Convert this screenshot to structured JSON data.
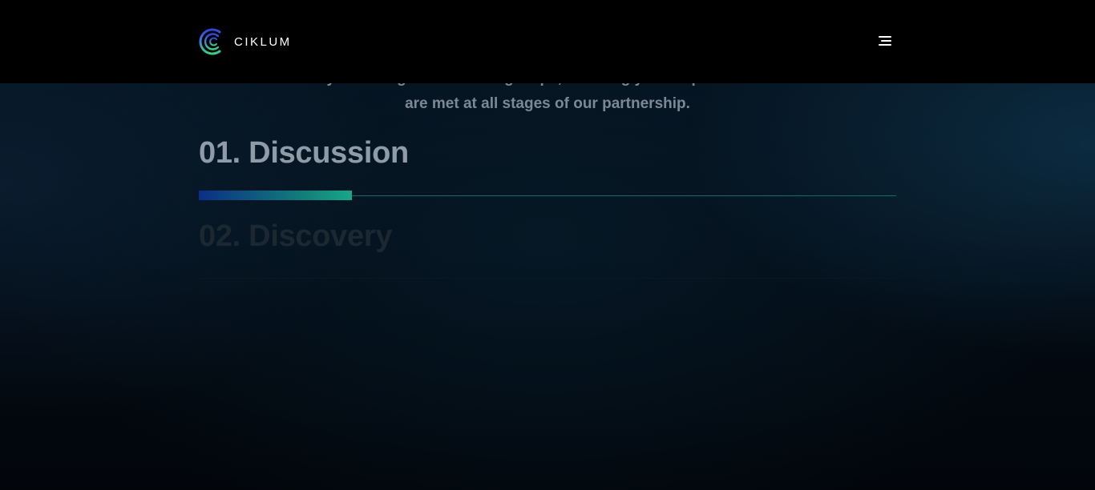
{
  "header": {
    "brand_name": "CIKLUM",
    "menu_icon": "hamburger-menu-icon"
  },
  "intro": {
    "line_1": "you through the following steps, ensuring your requirements",
    "line_2": "are met at all stages of our partnership."
  },
  "steps": [
    {
      "label": "01. Discussion",
      "state": "active"
    },
    {
      "label": "02. Discovery",
      "state": "inactive"
    }
  ],
  "progress": {
    "fraction": 0.22
  },
  "colors": {
    "header_bg": "#000000",
    "accent_blue": "#0a2f86",
    "accent_green": "#16a889",
    "track": "#0e6a62"
  }
}
